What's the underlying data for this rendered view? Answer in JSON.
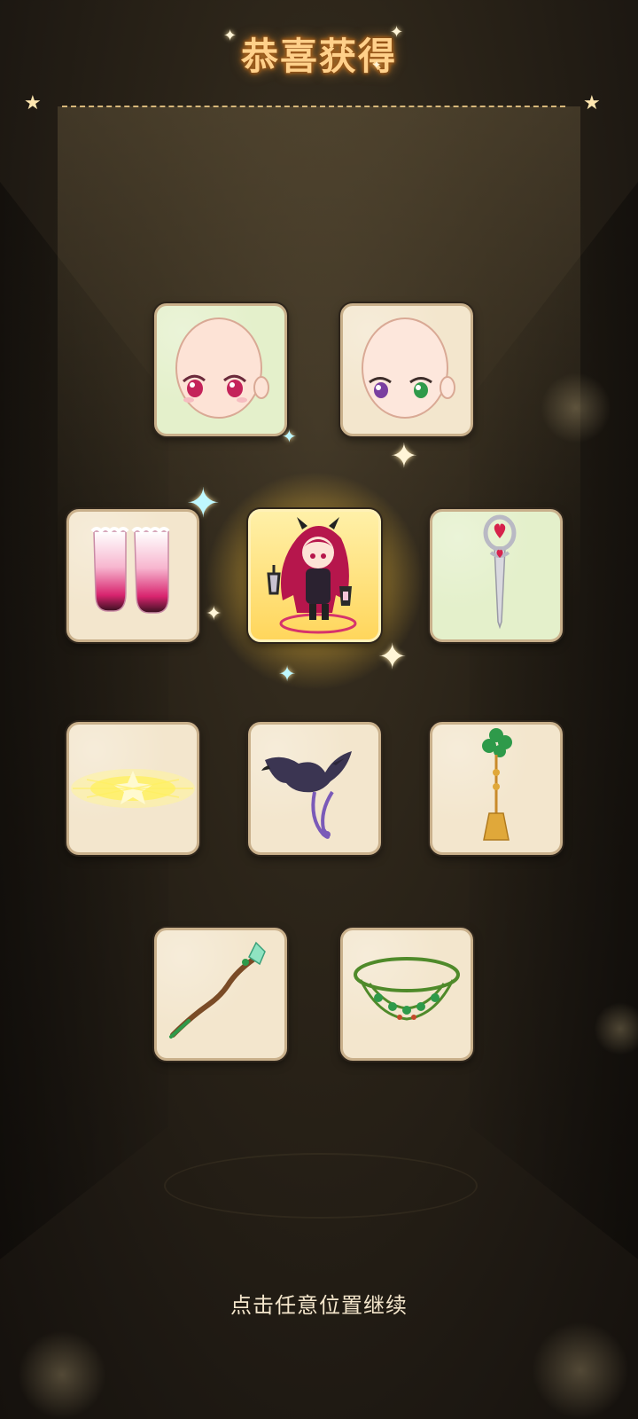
{
  "title": "恭喜获得",
  "hint": "点击任意位置继续",
  "rewards": [
    {
      "name": "face-pink-eyes",
      "bg": "green"
    },
    {
      "name": "face-heterochromia-eyes",
      "bg": "beige"
    },
    {
      "name": "stockings-pink-gradient",
      "bg": "beige"
    },
    {
      "name": "character-lantern-girl",
      "bg": "featured"
    },
    {
      "name": "wand-heart-scepter",
      "bg": "green"
    },
    {
      "name": "light-wings-yellow",
      "bg": "beige"
    },
    {
      "name": "crow-companion",
      "bg": "beige"
    },
    {
      "name": "clover-tassel-ornament",
      "bg": "beige"
    },
    {
      "name": "wooden-crystal-staff",
      "bg": "beige"
    },
    {
      "name": "green-bead-necklace",
      "bg": "beige"
    }
  ],
  "colors": {
    "title": "#ffd08a",
    "card_border": "#c9b08b",
    "card_beige": "#f3e6cd",
    "card_green": "#e4f0cb"
  }
}
